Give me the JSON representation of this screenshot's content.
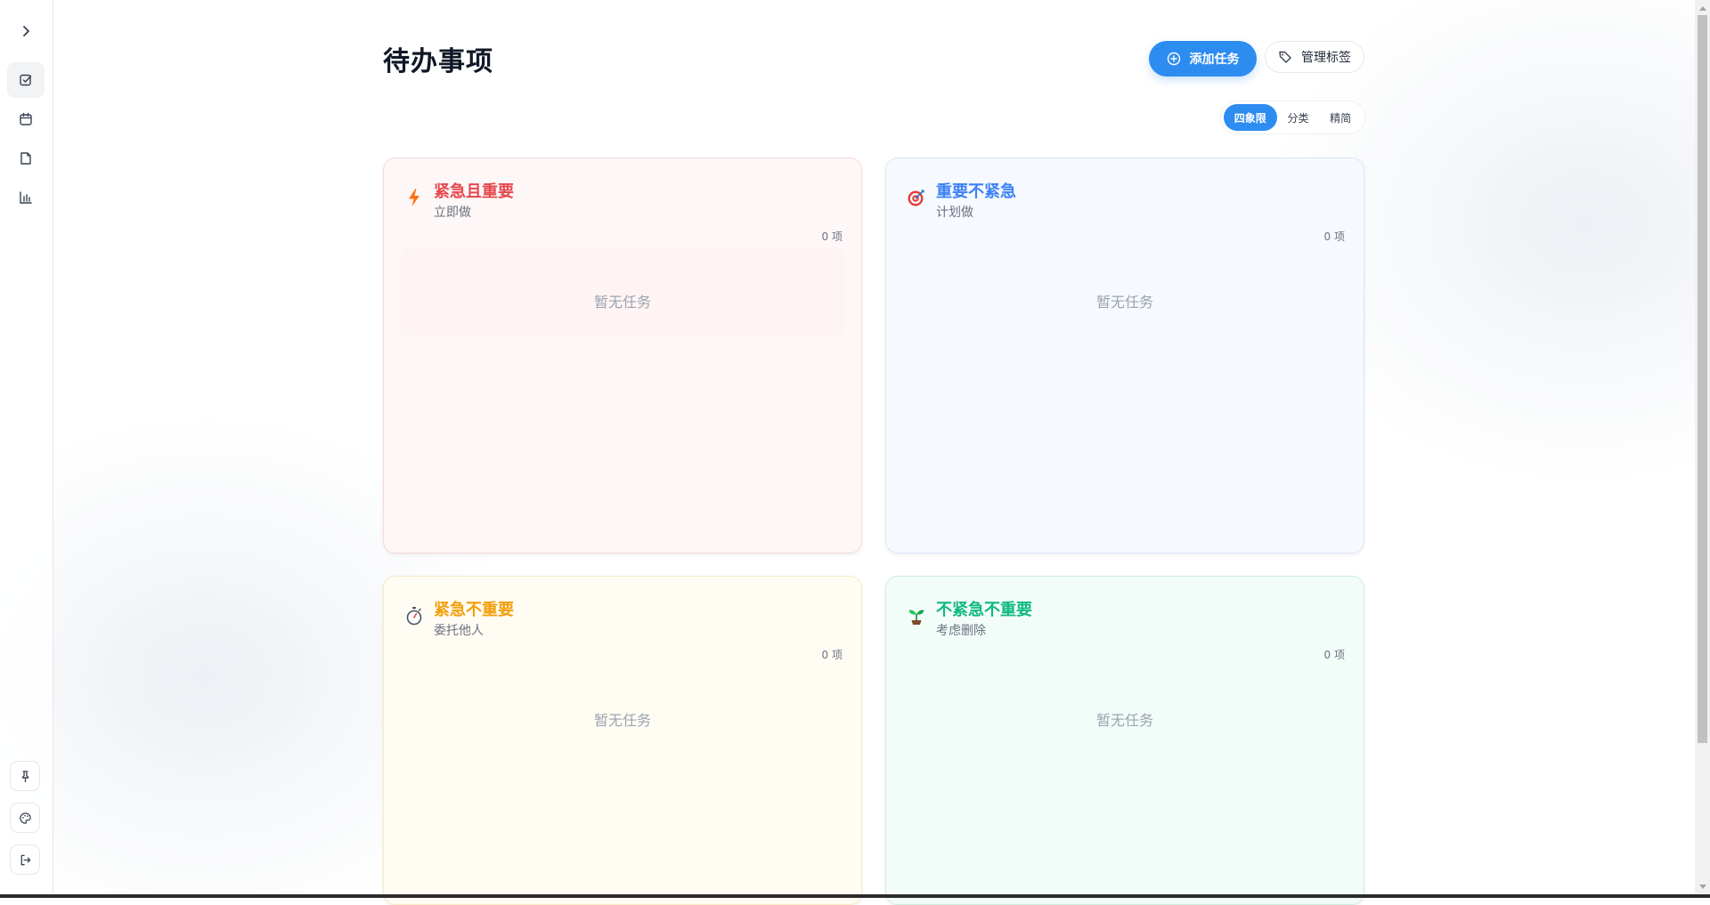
{
  "sidebar": {
    "toggle_icon": "chevron-right-icon",
    "nav": [
      {
        "icon": "checkbox-icon",
        "active": true
      },
      {
        "icon": "calendar-icon",
        "active": false
      },
      {
        "icon": "document-icon",
        "active": false
      },
      {
        "icon": "bar-chart-icon",
        "active": false
      }
    ],
    "bottom": [
      "pin-icon",
      "palette-icon",
      "logout-icon"
    ]
  },
  "header": {
    "title": "待办事项",
    "add_task_label": "添加任务",
    "manage_tags_label": "管理标签"
  },
  "view_switch": {
    "options": [
      "四象限",
      "分类",
      "精简"
    ],
    "selected": "四象限"
  },
  "quadrants": [
    {
      "title": "紧急且重要",
      "subtitle": "立即做",
      "count": "0 项",
      "empty": "暂无任务",
      "icon": "lightning-icon",
      "color": "#e5484d"
    },
    {
      "title": "重要不紧急",
      "subtitle": "计划做",
      "count": "0 项",
      "empty": "暂无任务",
      "icon": "target-icon",
      "color": "#3b82f6"
    },
    {
      "title": "紧急不重要",
      "subtitle": "委托他人",
      "count": "0 项",
      "empty": "暂无任务",
      "icon": "stopwatch-icon",
      "color": "#f59e0b"
    },
    {
      "title": "不紧急不重要",
      "subtitle": "考虑删除",
      "count": "0 项",
      "empty": "暂无任务",
      "icon": "seedling-icon",
      "color": "#10b981"
    }
  ],
  "colors": {
    "accent": "#2d8cf0"
  }
}
